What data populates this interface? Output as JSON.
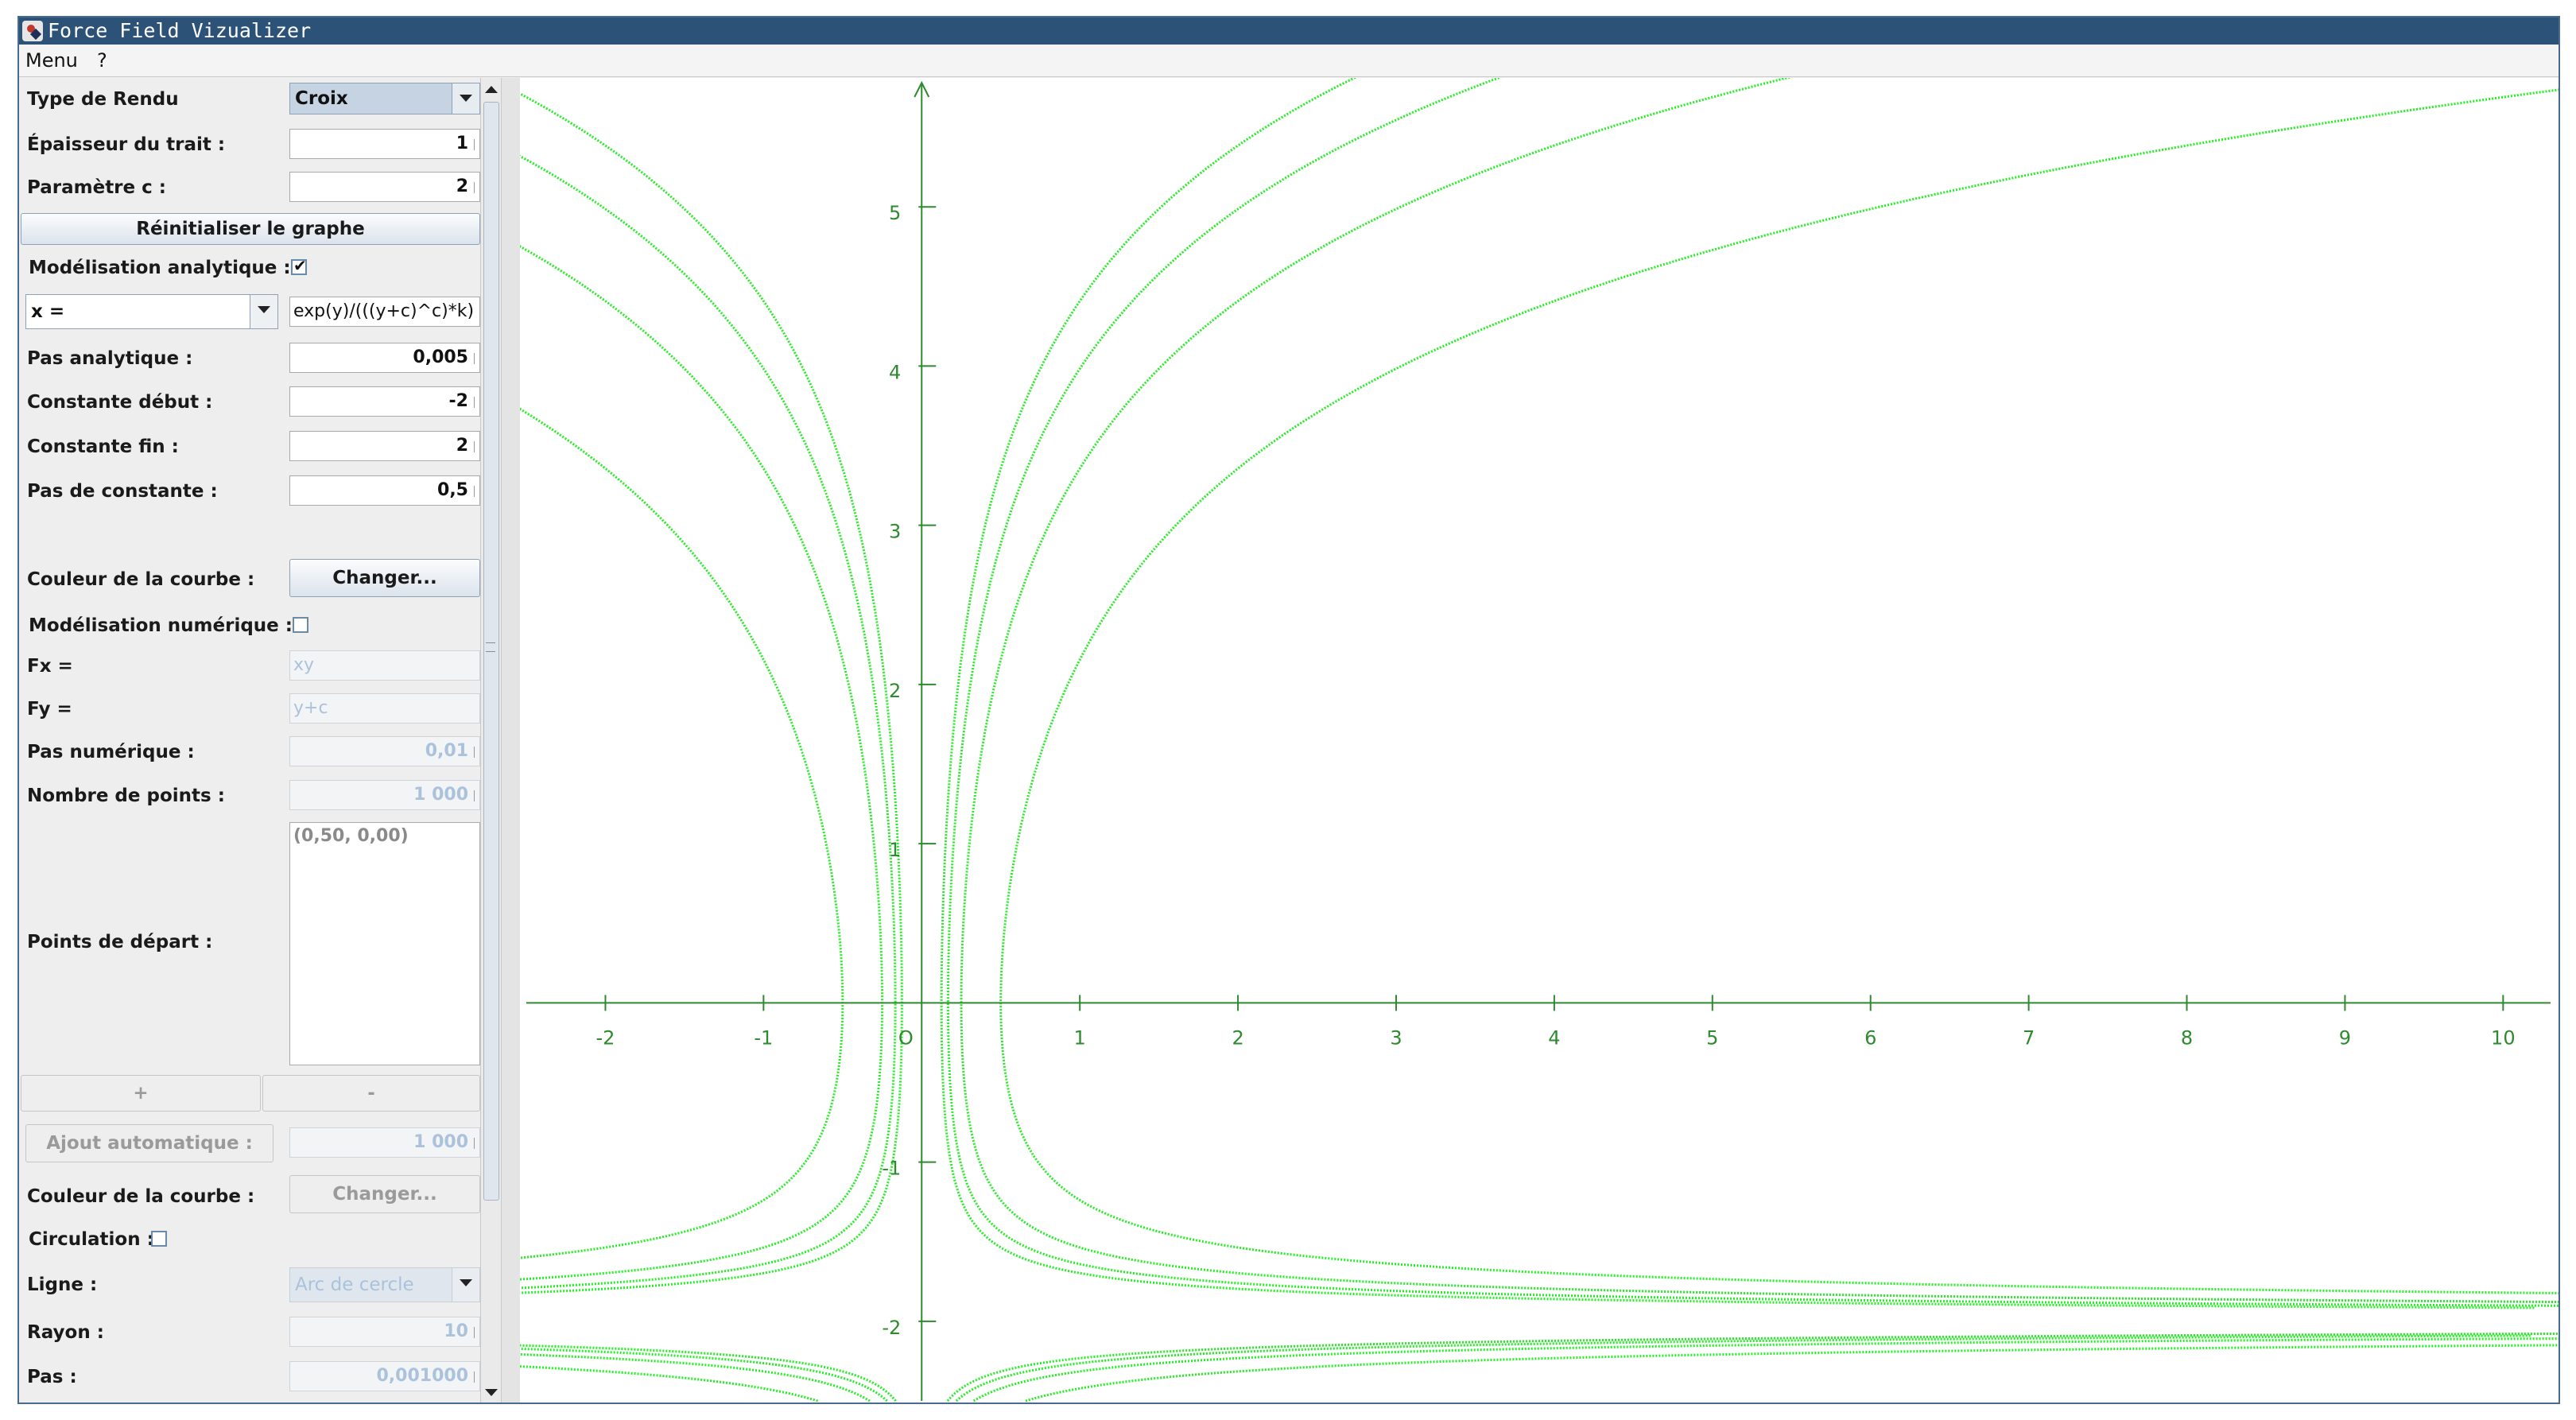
{
  "window": {
    "title": "Force Field Vizualizer"
  },
  "menubar": {
    "items": [
      "Menu",
      "?"
    ]
  },
  "panel": {
    "type_rendu": {
      "label": "Type de Rendu",
      "value": "Croix"
    },
    "epaisseur": {
      "label": "Épaisseur du trait :",
      "value": "1"
    },
    "param_c": {
      "label": "Paramètre c :",
      "value": "2"
    },
    "reset_button": "Réinitialiser le graphe",
    "analytique": {
      "label": "Modélisation analytique :",
      "checked": true
    },
    "equation": {
      "var": "x =",
      "expr": "exp(y)/(((y+c)^c)*k)"
    },
    "pas_analytique": {
      "label": "Pas analytique :",
      "value": "0,005"
    },
    "constante_debut": {
      "label": "Constante début :",
      "value": "-2"
    },
    "constante_fin": {
      "label": "Constante fin :",
      "value": "2"
    },
    "pas_constante": {
      "label": "Pas de constante :",
      "value": "0,5"
    },
    "couleur1": {
      "label": "Couleur de la courbe :",
      "button": "Changer..."
    },
    "numerique": {
      "label": "Modélisation numérique :",
      "checked": false
    },
    "fx": {
      "label": "Fx =",
      "value": "xy"
    },
    "fy": {
      "label": "Fy =",
      "value": "y+c"
    },
    "pas_numerique": {
      "label": "Pas numérique :",
      "value": "0,01"
    },
    "nb_points": {
      "label": "Nombre de points :",
      "value": "1 000"
    },
    "points_depart": {
      "label": "Points de départ :",
      "value": "(0,50, 0,00)"
    },
    "plus_button": "+",
    "minus_button": "-",
    "ajout_auto": {
      "button": "Ajout automatique :",
      "value": "1 000"
    },
    "couleur2": {
      "label": "Couleur de la courbe :",
      "button": "Changer..."
    },
    "circulation": {
      "label": "Circulation :",
      "checked": false
    },
    "ligne": {
      "label": "Ligne :",
      "value": "Arc de cercle"
    },
    "rayon": {
      "label": "Rayon :",
      "value": "10"
    },
    "pas": {
      "label": "Pas :",
      "value": "0,001000"
    }
  },
  "chart_data": {
    "type": "line",
    "curve_color": "#22ee22",
    "axis_color": "#2f8a2f",
    "x_ticks": [
      "-2",
      "-1",
      "O",
      "1",
      "2",
      "3",
      "4",
      "5",
      "6",
      "7",
      "8",
      "9",
      "10"
    ],
    "y_ticks": [
      "5",
      "4",
      "3",
      "2",
      "1",
      "-1",
      "-2"
    ],
    "xlim": [
      -2.5,
      10.3
    ],
    "ylim": [
      -2.5,
      5.8
    ],
    "constants_k": [
      -2,
      -1.5,
      -1,
      -0.5,
      0.5,
      1,
      1.5,
      2
    ],
    "c": 2,
    "grid": false
  }
}
